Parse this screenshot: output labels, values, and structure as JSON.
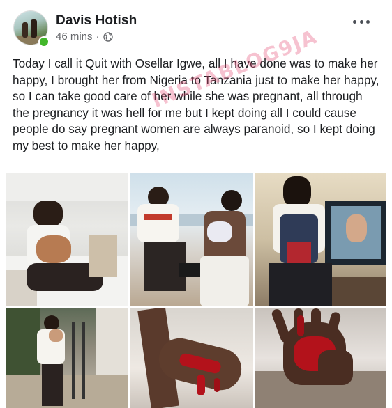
{
  "post": {
    "author": "Davis Hotish",
    "time": "46 mins",
    "separator": "·",
    "privacy_icon": "globe-icon",
    "more_icon": "more-options-icon",
    "text": "Today I call it Quit with Osellar Igwe, all I have done was to make her happy, I brought her from Nigeria to Tanzania just to make her happy, so I can take good care of her while she was pregnant, all through the pregnancy it was hell for me but I kept doing all I could cause people do say pregnant women are always paranoid, so I kept doing my best to make her happy,",
    "watermark": "INSTABLOG9JA"
  },
  "photos": [
    {
      "subject": "man-holding-baby-hospital"
    },
    {
      "subject": "couple-with-baby-on-deck"
    },
    {
      "subject": "man-with-baby-carrier"
    },
    {
      "subject": "man-holding-baby-stairs"
    },
    {
      "subject": "bleeding-forearm"
    },
    {
      "subject": "bleeding-hand"
    }
  ],
  "colors": {
    "name": "#1c1e21",
    "meta": "#65676b",
    "online": "#42b72a",
    "blood": "#b3121b"
  }
}
